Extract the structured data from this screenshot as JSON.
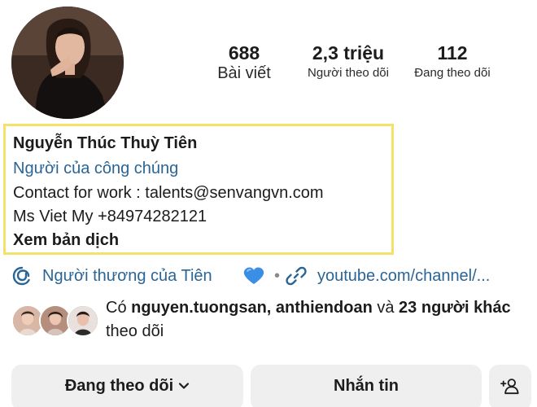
{
  "profile": {
    "avatar_icon": "profile-photo"
  },
  "stats": {
    "posts_value": "688",
    "posts_label": "Bài viết",
    "followers_value": "2,3 triệu",
    "followers_label": "Người theo dõi",
    "following_value": "112",
    "following_label": "Đang theo dõi"
  },
  "bio": {
    "name": "Nguyễn Thúc Thuỳ Tiên",
    "category": "Người của công chúng",
    "contact": "Contact for work : talents@senvangvn.com",
    "phone": "Ms Viet My +84974282121",
    "translate": "Xem bản dịch"
  },
  "links": {
    "thread_text": "Người thương của Tiên",
    "separator": "•",
    "youtube_text": "youtube.com/channel/...",
    "accent_color": "#2a6597",
    "heart_color": "#3b8ee6"
  },
  "followed_by": {
    "prefix": "Có ",
    "users": "nguyen.tuongsan, anthiendoan",
    "middle": " và ",
    "others": "23 người khác",
    "suffix": " theo dõi"
  },
  "actions": {
    "following_label": "Đang theo dõi",
    "message_label": "Nhắn tin",
    "add_user_icon": "add-person-icon"
  },
  "highlight_color": "#f5e16a"
}
